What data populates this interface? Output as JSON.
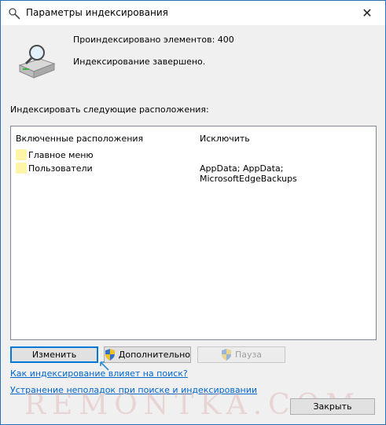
{
  "window": {
    "title": "Параметры индексирования",
    "close_glyph": "✕"
  },
  "stats": {
    "indexed": "Проиндексировано элементов: 400",
    "status": "Индексирование завершено."
  },
  "locations": {
    "label": "Индексировать следующие расположения:",
    "columns": [
      "Включенные расположения",
      "Исключить"
    ],
    "rows": [
      {
        "location": "Главное меню",
        "exclude": ""
      },
      {
        "location": "Пользователи",
        "exclude": "AppData; AppData; MicrosoftEdgeBackups"
      }
    ]
  },
  "buttons": {
    "change": "Изменить",
    "advanced": "Дополнительно",
    "pause": "Пауза",
    "close": "Закрыть"
  },
  "links": {
    "how_affects": "Как индексирование влияет на поиск?",
    "troubleshoot": "Устранение неполадок при поиске и индексировании"
  },
  "watermark": "REMONTKA.COM",
  "colors": {
    "accent": "#0078d7",
    "link": "#0066cc",
    "folder": "#fff5a6"
  },
  "icons": {
    "title": "indexing-options-icon",
    "status": "drive-magnifier-icon",
    "shield": "uac-shield-icon",
    "folder": "folder-icon",
    "cursor": "hand-cursor-icon"
  }
}
